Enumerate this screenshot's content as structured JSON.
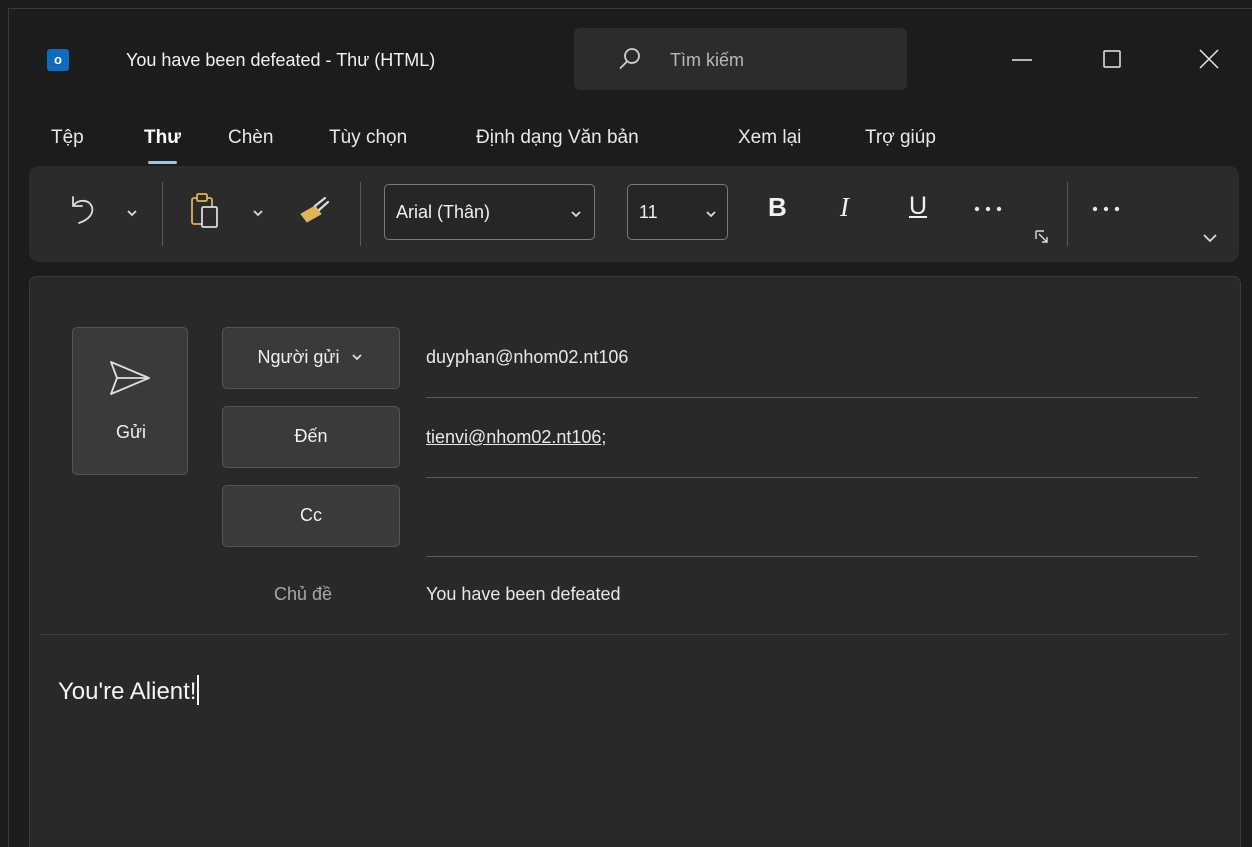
{
  "window": {
    "title": "You have been defeated  -  Thư (HTML)",
    "app_icon_letter": "o",
    "search_placeholder": "Tìm kiếm"
  },
  "tabs": [
    {
      "label": "Tệp",
      "active": false
    },
    {
      "label": "Thư",
      "active": true
    },
    {
      "label": "Chèn",
      "active": false
    },
    {
      "label": "Tùy chọn",
      "active": false
    },
    {
      "label": "Định dạng Văn bản",
      "active": false
    },
    {
      "label": "Xem lại",
      "active": false
    },
    {
      "label": "Trợ giúp",
      "active": false
    }
  ],
  "ribbon": {
    "font_name": "Arial (Thân)",
    "font_size": "11",
    "bold_glyph": "B",
    "italic_glyph": "I",
    "underline_glyph": "U"
  },
  "compose": {
    "send_label": "Gửi",
    "from_button": "Người gửi",
    "from_value": "duyphan@nhom02.nt106",
    "to_button": "Đến",
    "to_value": "tienvi@nhom02.nt106",
    "to_separator": ";",
    "cc_button": "Cc",
    "cc_value": "",
    "subject_label": "Chủ đề",
    "subject_value": "You have been defeated",
    "body_text": "You're Alient!"
  },
  "colors": {
    "background": "#1c1c1c",
    "ribbon": "#2b2b2b",
    "card": "#292929",
    "accent": "#9fc3e8",
    "outlook_blue": "#0f6cbd"
  }
}
